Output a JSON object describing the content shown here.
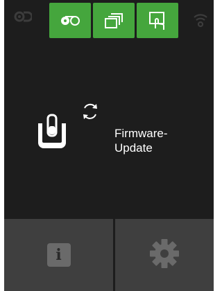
{
  "status_bar": {
    "left_icon": "tape-reel-status-icon",
    "right_icon": "wifi-icon"
  },
  "tabs": [
    {
      "icon": "tape-reel-icon",
      "active": true
    },
    {
      "icon": "stacked-pages-icon",
      "active": true
    },
    {
      "icon": "touch-screen-icon",
      "active": true
    }
  ],
  "main": {
    "status_lines": "Firmware-\nUpdate",
    "product_icon": "vial-holder-icon",
    "progress_icon": "refresh-icon"
  },
  "bottom_buttons": {
    "info_glyph": "i",
    "settings_icon": "gear-icon"
  },
  "colors": {
    "background": "#1d1d1d",
    "accent": "#45a63d",
    "button": "#3f3f3f",
    "text": "#ffffff"
  }
}
